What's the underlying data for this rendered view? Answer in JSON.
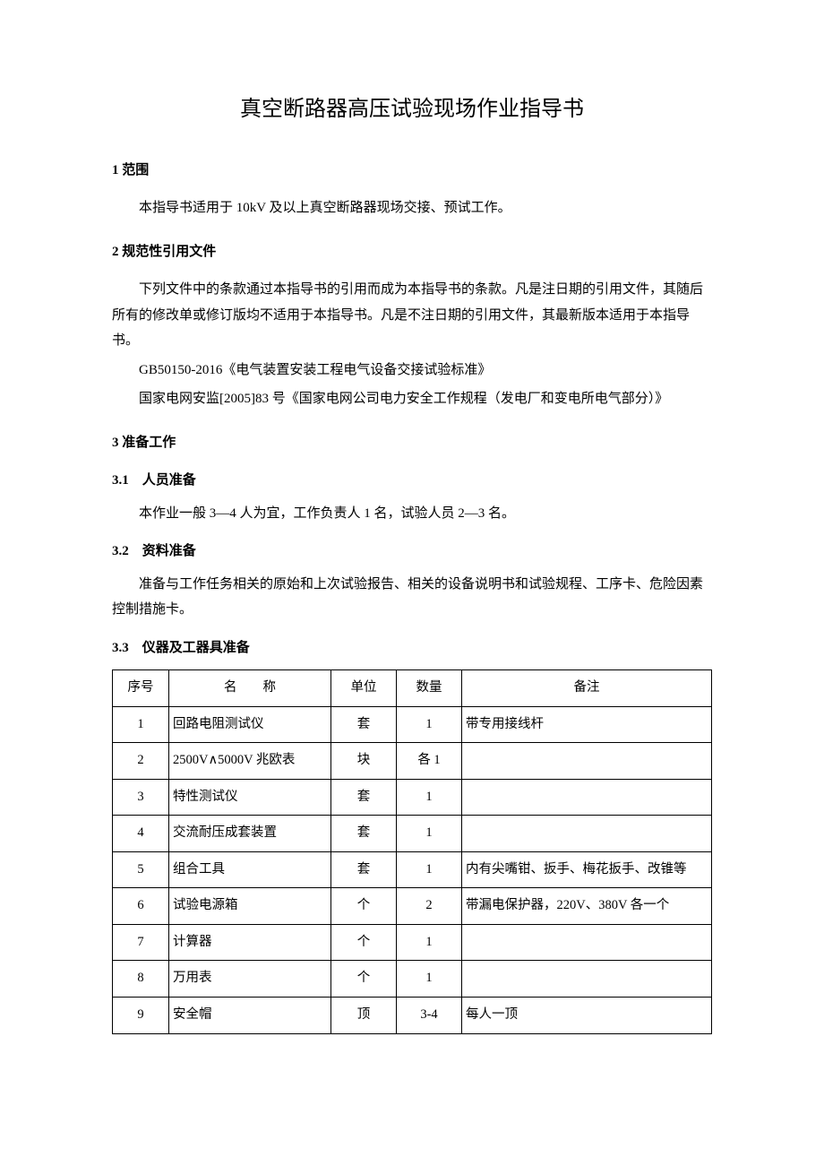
{
  "title": "真空断路器高压试验现场作业指导书",
  "sections": {
    "s1": {
      "heading": "1 范围",
      "p1": "本指导书适用于 10kV 及以上真空断路器现场交接、预试工作。"
    },
    "s2": {
      "heading": "2 规范性引用文件",
      "p1": "下列文件中的条款通过本指导书的引用而成为本指导书的条款。凡是注日期的引用文件，其随后所有的修改单或修订版均不适用于本指导书。凡是不注日期的引用文件，其最新版本适用于本指导书。",
      "p2": "GB50150-2016《电气装置安装工程电气设备交接试验标准》",
      "p3": "国家电网安监[2005]83 号《国家电网公司电力安全工作规程（发电厂和变电所电气部分）》"
    },
    "s3": {
      "heading": "3 准备工作",
      "s3_1": {
        "heading": "3.1　人员准备",
        "p1": "本作业一般 3—4 人为宜，工作负责人 1 名，试验人员 2—3 名。"
      },
      "s3_2": {
        "heading": "3.2　资料准备",
        "p1": "准备与工作任务相关的原始和上次试验报告、相关的设备说明书和试验规程、工序卡、危险因素控制措施卡。"
      },
      "s3_3": {
        "heading": "3.3　仪器及工器具准备"
      }
    }
  },
  "table": {
    "headers": {
      "idx": "序号",
      "name": "名称",
      "unit": "单位",
      "qty": "数量",
      "remark": "备注"
    },
    "rows": [
      {
        "idx": "1",
        "name": "回路电阻测试仪",
        "unit": "套",
        "qty": "1",
        "remark": "带专用接线杆"
      },
      {
        "idx": "2",
        "name": "2500V∧5000V 兆欧表",
        "unit": "块",
        "qty": "各 1",
        "remark": ""
      },
      {
        "idx": "3",
        "name": "特性测试仪",
        "unit": "套",
        "qty": "1",
        "remark": ""
      },
      {
        "idx": "4",
        "name": "交流耐压成套装置",
        "unit": "套",
        "qty": "1",
        "remark": ""
      },
      {
        "idx": "5",
        "name": "组合工具",
        "unit": "套",
        "qty": "1",
        "remark": "内有尖嘴钳、扳手、梅花扳手、改锥等"
      },
      {
        "idx": "6",
        "name": "试验电源箱",
        "unit": "个",
        "qty": "2",
        "remark": "带漏电保护器，220V、380V 各一个"
      },
      {
        "idx": "7",
        "name": "计算器",
        "unit": "个",
        "qty": "1",
        "remark": ""
      },
      {
        "idx": "8",
        "name": "万用表",
        "unit": "个",
        "qty": "1",
        "remark": ""
      },
      {
        "idx": "9",
        "name": "安全帽",
        "unit": "顶",
        "qty": "3-4",
        "remark": "每人一顶"
      }
    ]
  }
}
